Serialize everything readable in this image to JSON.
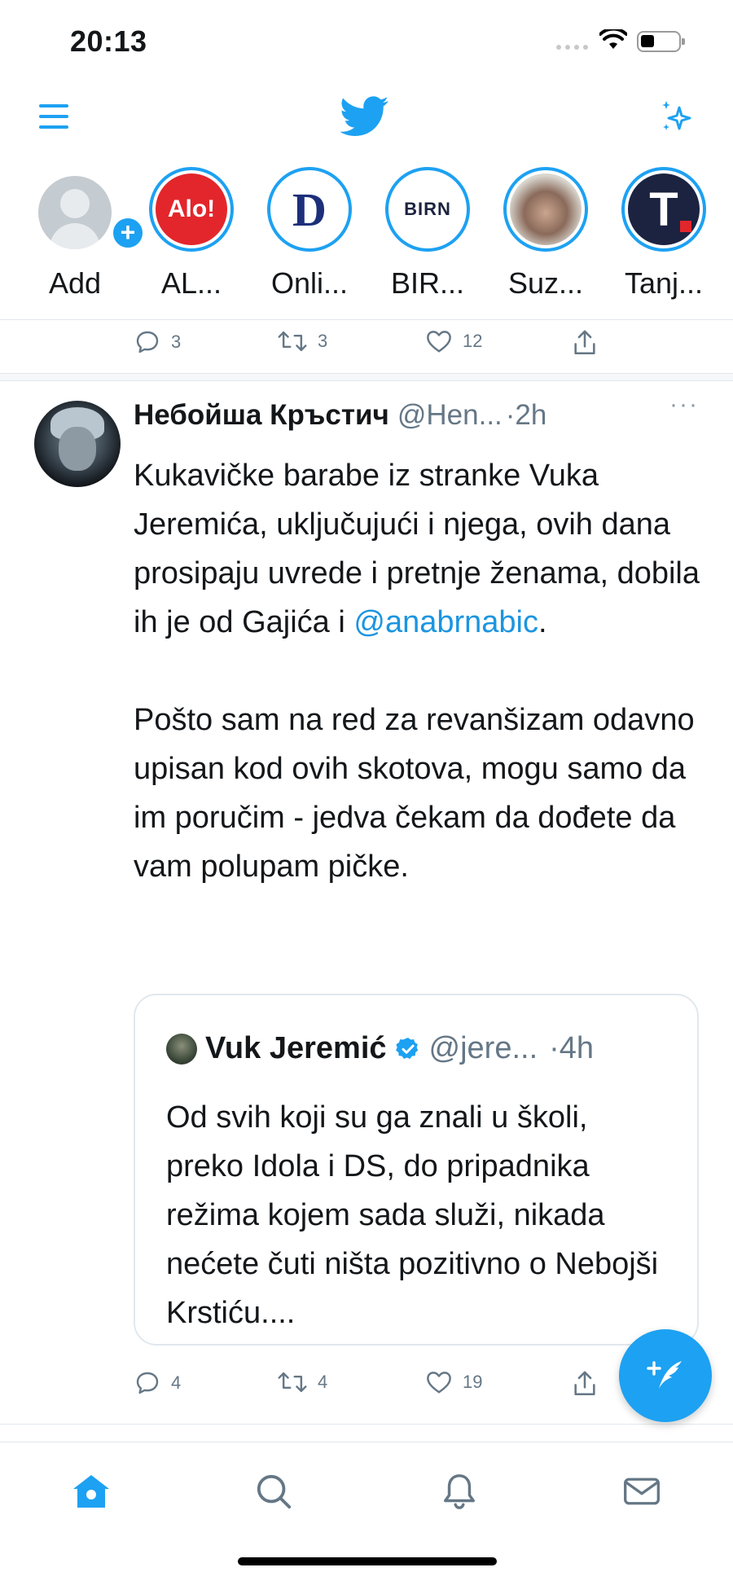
{
  "status_bar": {
    "time": "20:13"
  },
  "fleets": [
    {
      "label": "Add",
      "kind": "add"
    },
    {
      "label": "AL...",
      "kind": "alo",
      "badge": "Alo!"
    },
    {
      "label": "Onli...",
      "kind": "d",
      "badge": "D"
    },
    {
      "label": "BIR...",
      "kind": "birn",
      "badge": "BIRN"
    },
    {
      "label": "Suz...",
      "kind": "photo"
    },
    {
      "label": "Tanj...",
      "kind": "t",
      "badge": "T"
    }
  ],
  "prev_tweet_actions": {
    "replies": "3",
    "retweets": "3",
    "likes": "12"
  },
  "tweet": {
    "author_name": "Небойша Кръстич",
    "author_handle": "@Hen...",
    "time": "·2h",
    "text_line1": "Kukavičke barabe iz stranke Vuka Jeremića, uključujući i njega, ovih dana prosipaju uvrede i pretnje ženama, dobila ih je od Gajića i ",
    "mention": "@anabrnabic",
    "text_line1_end": ".",
    "text_para2": "Pošto sam na red za revanšizam odavno upisan kod ovih skotova, mogu samo da im poručim - jedva čekam da dođete da vam polupam pičke.",
    "quote": {
      "name": "Vuk Jeremić",
      "handle": "@jere...",
      "time": "·4h",
      "text": "Od svih koji su ga znali u školi, preko Idola i DS, do pripadnika režima kojem sada služi, nikada nećete čuti ništa pozitivno o Nebojši Krstiću...."
    },
    "actions": {
      "replies": "4",
      "retweets": "4",
      "likes": "19"
    }
  },
  "colors": {
    "accent": "#1da1f2",
    "muted": "#657786",
    "alo_red": "#e3262b",
    "d_navy": "#1d2f7a",
    "t_navy": "#1c2340"
  },
  "icons": [
    "menu-icon",
    "twitter-bird-icon",
    "sparkle-icon",
    "reply-icon",
    "retweet-icon",
    "like-icon",
    "share-icon",
    "more-icon",
    "verified-icon",
    "compose-icon",
    "home-icon",
    "search-icon",
    "notifications-icon",
    "messages-icon"
  ]
}
